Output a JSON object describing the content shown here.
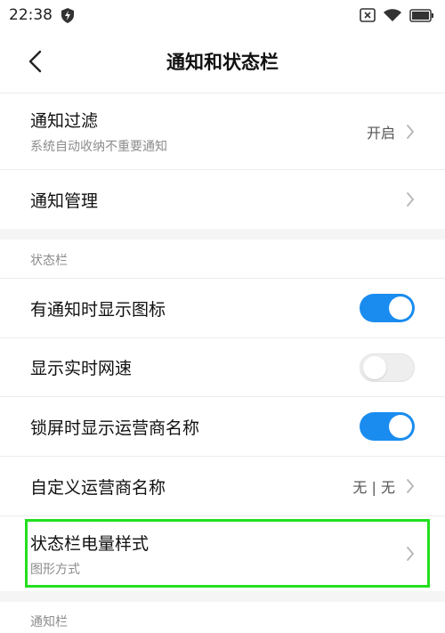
{
  "status_bar": {
    "time": "22:38",
    "icons": [
      "shield-bolt-icon",
      "sim-x-icon",
      "wifi-icon",
      "battery-icon"
    ]
  },
  "header": {
    "title": "通知和状态栏",
    "back_icon": "chevron-left-icon"
  },
  "notifications": {
    "filter": {
      "title": "通知过滤",
      "subtitle": "系统自动收纳不重要通知",
      "value": "开启"
    },
    "manage": {
      "title": "通知管理"
    }
  },
  "status_bar_section": {
    "header": "状态栏",
    "items": [
      {
        "title": "有通知时显示图标",
        "toggle": true
      },
      {
        "title": "显示实时网速",
        "toggle": false
      },
      {
        "title": "锁屏时显示运营商名称",
        "toggle": true
      }
    ],
    "custom_carrier": {
      "title": "自定义运营商名称",
      "value": "无 | 无"
    },
    "battery_style": {
      "title": "状态栏电量样式",
      "subtitle": "图形方式"
    }
  },
  "notification_bar_section": {
    "header": "通知栏"
  },
  "colors": {
    "accent": "#1a8cf0",
    "highlight": "#22e01e",
    "section_bg": "#f5f5f5",
    "secondary_text": "#8c8c8c"
  }
}
